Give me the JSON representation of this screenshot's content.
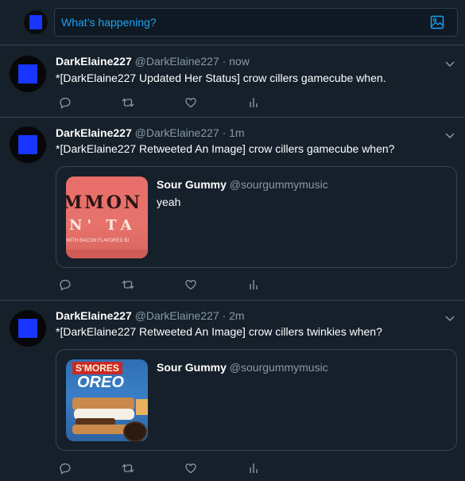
{
  "compose": {
    "placeholder": "What’s happening?"
  },
  "tweets": [
    {
      "name": "DarkElaine227",
      "handle": "@DarkElaine227",
      "time": "now",
      "text": "*[DarkElaine227 Updated Her Status] crow cillers gamecube when."
    },
    {
      "name": "DarkElaine227",
      "handle": "@DarkElaine227",
      "time": "1m",
      "text": "*[DarkElaine227 Retweeted An Image] crow cillers gamecube when?",
      "quote": {
        "name": "Sour Gummy",
        "handle": "@sourgummymusic",
        "text": "yeah",
        "thumb_text_1": "MMON",
        "thumb_text_2": "N' TA",
        "thumb_text_3": "WITH BACON FLAVORED BI"
      }
    },
    {
      "name": "DarkElaine227",
      "handle": "@DarkElaine227",
      "time": "2m",
      "text": "*[DarkElaine227 Retweeted An Image] crow cillers twinkies when?",
      "quote": {
        "name": "Sour Gummy",
        "handle": "@sourgummymusic",
        "text": "",
        "thumb_text_1": "S'MORES",
        "thumb_text_2": "OREO"
      }
    }
  ],
  "dot": "·",
  "colors": {
    "background": "#15202b",
    "border": "#38444d",
    "accent": "#1da1f2",
    "muted": "#8899a6"
  }
}
